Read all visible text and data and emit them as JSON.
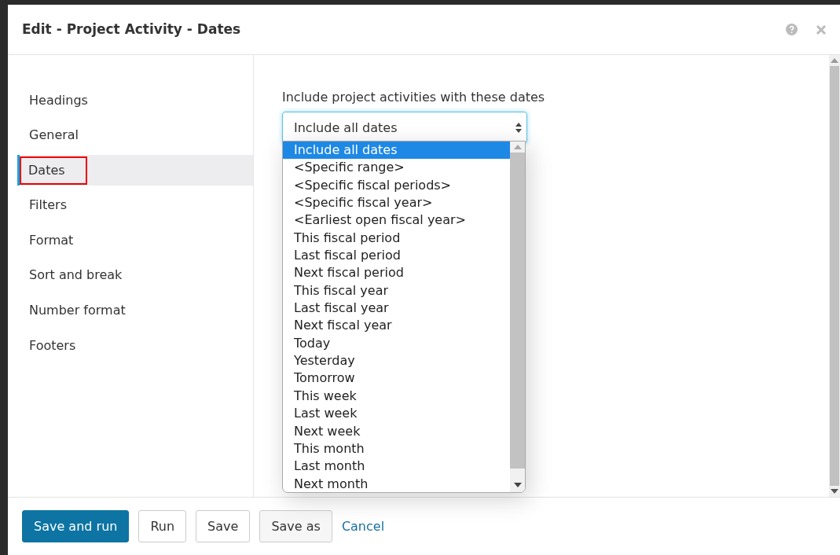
{
  "dialog": {
    "title": "Edit - Project Activity  - Dates"
  },
  "sidebar": {
    "items": [
      {
        "label": "Headings",
        "selected": false,
        "outlined": false
      },
      {
        "label": "General",
        "selected": false,
        "outlined": false
      },
      {
        "label": "Dates",
        "selected": true,
        "outlined": true
      },
      {
        "label": "Filters",
        "selected": false,
        "outlined": false
      },
      {
        "label": "Format",
        "selected": false,
        "outlined": false
      },
      {
        "label": "Sort and break",
        "selected": false,
        "outlined": false
      },
      {
        "label": "Number format",
        "selected": false,
        "outlined": false
      },
      {
        "label": "Footers",
        "selected": false,
        "outlined": false
      }
    ]
  },
  "dates": {
    "label": "Include project activities with these dates",
    "select": {
      "value": "Include all dates",
      "expanded": true
    },
    "options": [
      {
        "label": "Include all dates",
        "selected": true
      },
      {
        "label": "<Specific range>",
        "selected": false
      },
      {
        "label": "<Specific fiscal periods>",
        "selected": false
      },
      {
        "label": "<Specific fiscal year>",
        "selected": false
      },
      {
        "label": "<Earliest open fiscal year>",
        "selected": false
      },
      {
        "label": "This fiscal period",
        "selected": false
      },
      {
        "label": "Last fiscal period",
        "selected": false
      },
      {
        "label": "Next fiscal period",
        "selected": false
      },
      {
        "label": "This fiscal year",
        "selected": false
      },
      {
        "label": "Last fiscal year",
        "selected": false
      },
      {
        "label": "Next fiscal year",
        "selected": false
      },
      {
        "label": "Today",
        "selected": false
      },
      {
        "label": "Yesterday",
        "selected": false
      },
      {
        "label": "Tomorrow",
        "selected": false
      },
      {
        "label": "This week",
        "selected": false
      },
      {
        "label": "Last week",
        "selected": false
      },
      {
        "label": "Next week",
        "selected": false
      },
      {
        "label": "This month",
        "selected": false
      },
      {
        "label": "Last month",
        "selected": false
      },
      {
        "label": "Next month",
        "selected": false
      }
    ]
  },
  "footer": {
    "buttons": [
      {
        "label": "Save and run",
        "kind": "primary"
      },
      {
        "label": "Run",
        "kind": "outline"
      },
      {
        "label": "Save",
        "kind": "outline"
      },
      {
        "label": "Save as",
        "kind": "shaded"
      },
      {
        "label": "Cancel",
        "kind": "link"
      }
    ]
  }
}
